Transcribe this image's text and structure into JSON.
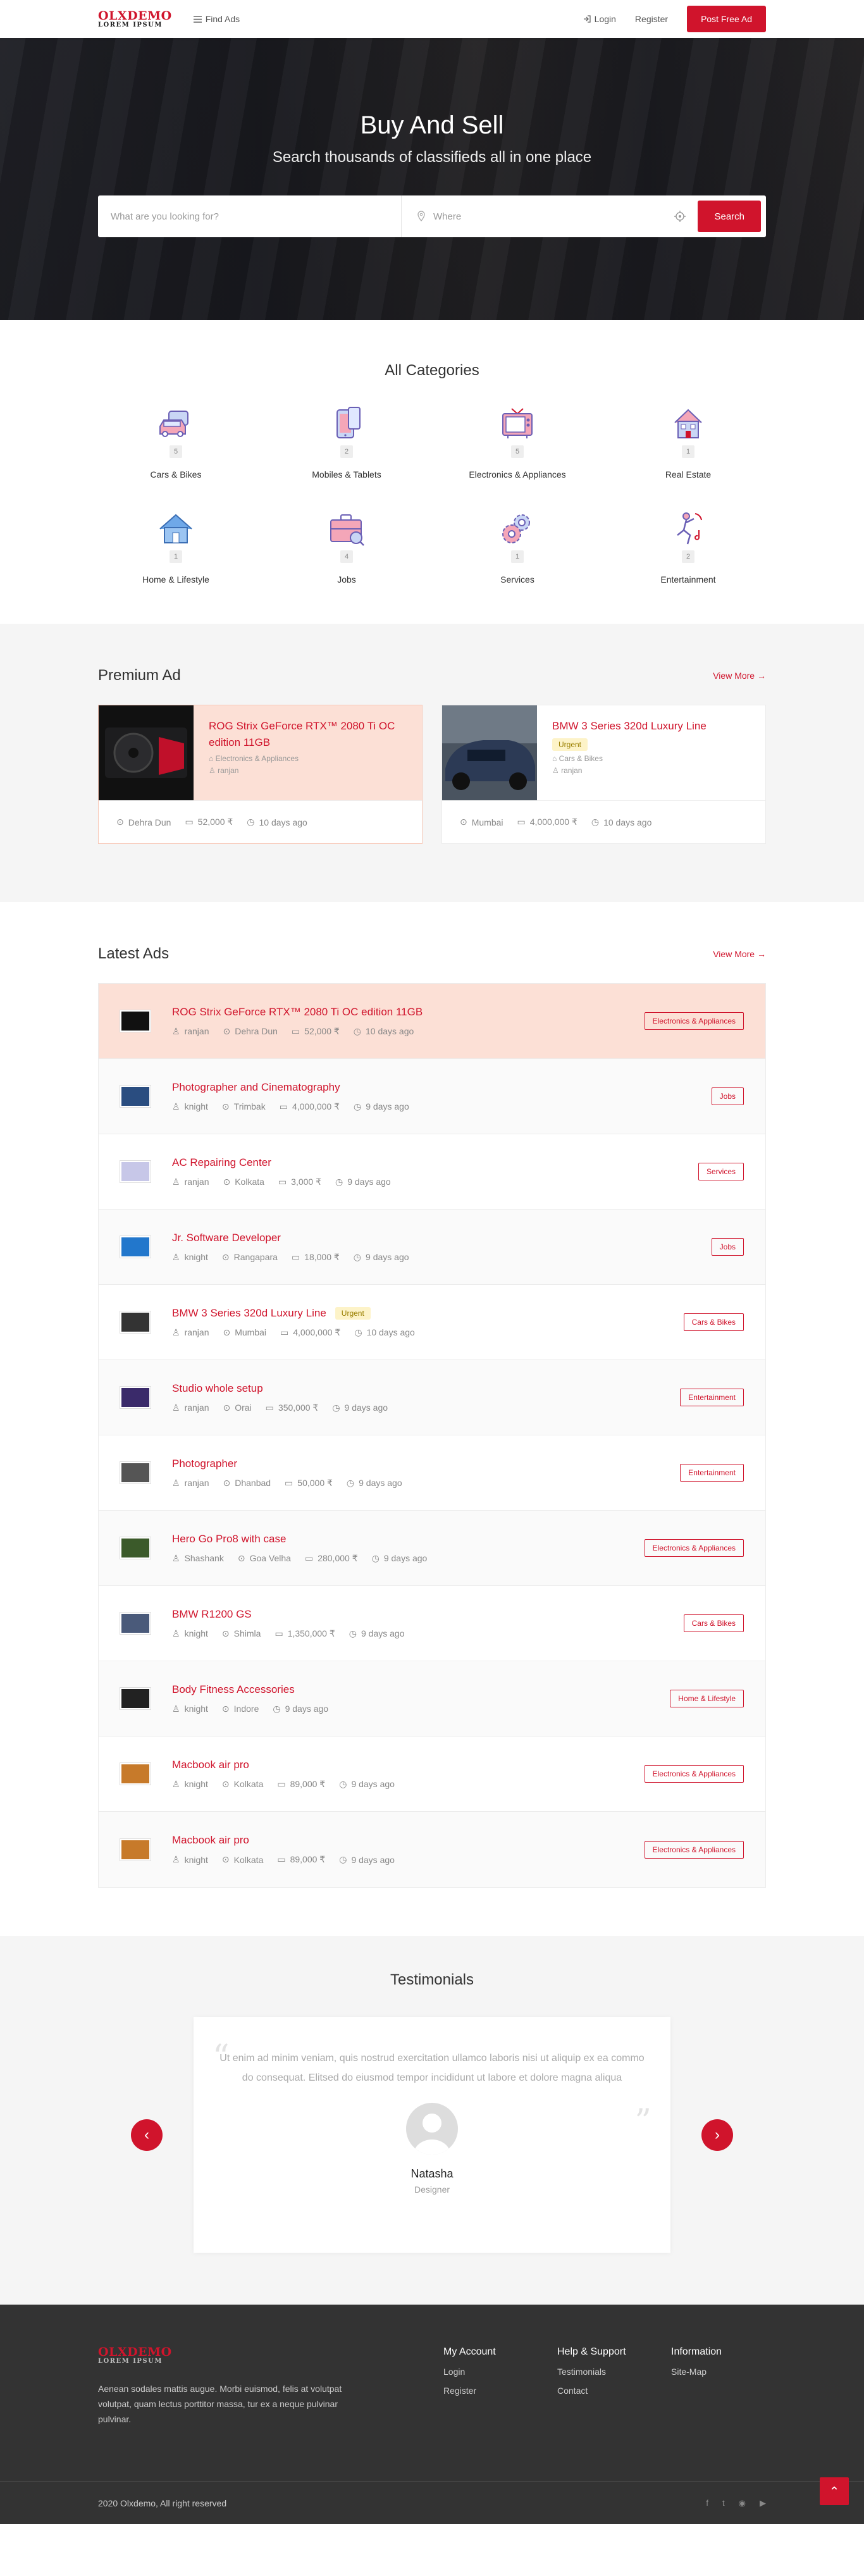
{
  "header": {
    "logo_main": "OLXDEMO",
    "logo_sub": "LOREM IPSUM",
    "find_ads": "Find Ads",
    "login": "Login",
    "register": "Register",
    "post_ad": "Post Free Ad"
  },
  "hero": {
    "title": "Buy And Sell",
    "subtitle": "Search thousands of classifieds all in one place",
    "search_placeholder": "What are you looking for?",
    "where_placeholder": "Where",
    "search_button": "Search"
  },
  "categories": {
    "title": "All Categories",
    "items": [
      {
        "name": "Cars & Bikes",
        "count": "5",
        "icon": "car-icon"
      },
      {
        "name": "Mobiles & Tablets",
        "count": "2",
        "icon": "mobile-icon"
      },
      {
        "name": "Electronics & Appliances",
        "count": "5",
        "icon": "tv-icon"
      },
      {
        "name": "Real Estate",
        "count": "1",
        "icon": "building-icon"
      },
      {
        "name": "Home & Lifestyle",
        "count": "1",
        "icon": "home-icon"
      },
      {
        "name": "Jobs",
        "count": "4",
        "icon": "briefcase-icon"
      },
      {
        "name": "Services",
        "count": "1",
        "icon": "gears-icon"
      },
      {
        "name": "Entertainment",
        "count": "2",
        "icon": "dancer-icon"
      }
    ]
  },
  "premium": {
    "title": "Premium Ad",
    "view_more": "View More",
    "items": [
      {
        "title": "ROG Strix GeForce RTX™ 2080 Ti OC edition 11GB",
        "category": "Electronics & Appliances",
        "user": "ranjan",
        "location": "Dehra Dun",
        "price": "52,000 ₹",
        "time": "10 days ago",
        "tag": ""
      },
      {
        "title": "BMW 3 Series 320d Luxury Line",
        "category": "Cars & Bikes",
        "user": "ranjan",
        "location": "Mumbai",
        "price": "4,000,000 ₹",
        "time": "10 days ago",
        "tag": "Urgent"
      }
    ]
  },
  "latest": {
    "title": "Latest Ads",
    "view_more": "View More",
    "items": [
      {
        "title": "ROG Strix GeForce RTX™ 2080 Ti OC edition 11GB",
        "user": "ranjan",
        "location": "Dehra Dun",
        "price": "52,000 ₹",
        "time": "10 days ago",
        "category": "Electronics & Appliances",
        "tag": ""
      },
      {
        "title": "Photographer and Cinematography",
        "user": "knight",
        "location": "Trimbak",
        "price": "4,000,000 ₹",
        "time": "9 days ago",
        "category": "Jobs",
        "tag": ""
      },
      {
        "title": "AC Repairing Center",
        "user": "ranjan",
        "location": "Kolkata",
        "price": "3,000 ₹",
        "time": "9 days ago",
        "category": "Services",
        "tag": ""
      },
      {
        "title": "Jr. Software Developer",
        "user": "knight",
        "location": "Rangapara",
        "price": "18,000 ₹",
        "time": "9 days ago",
        "category": "Jobs",
        "tag": ""
      },
      {
        "title": "BMW 3 Series 320d Luxury Line",
        "user": "ranjan",
        "location": "Mumbai",
        "price": "4,000,000 ₹",
        "time": "10 days ago",
        "category": "Cars & Bikes",
        "tag": "Urgent"
      },
      {
        "title": "Studio whole setup",
        "user": "ranjan",
        "location": "Orai",
        "price": "350,000 ₹",
        "time": "9 days ago",
        "category": "Entertainment",
        "tag": ""
      },
      {
        "title": "Photographer",
        "user": "ranjan",
        "location": "Dhanbad",
        "price": "50,000 ₹",
        "time": "9 days ago",
        "category": "Entertainment",
        "tag": ""
      },
      {
        "title": "Hero Go Pro8 with case",
        "user": "Shashank",
        "location": "Goa Velha",
        "price": "280,000 ₹",
        "time": "9 days ago",
        "category": "Electronics & Appliances",
        "tag": ""
      },
      {
        "title": "BMW R1200 GS",
        "user": "knight",
        "location": "Shimla",
        "price": "1,350,000 ₹",
        "time": "9 days ago",
        "category": "Cars & Bikes",
        "tag": ""
      },
      {
        "title": "Body Fitness Accessories",
        "user": "knight",
        "location": "Indore",
        "price": "",
        "time": "9 days ago",
        "category": "Home & Lifestyle",
        "tag": ""
      },
      {
        "title": "Macbook air pro",
        "user": "knight",
        "location": "Kolkata",
        "price": "89,000 ₹",
        "time": "9 days ago",
        "category": "Electronics & Appliances",
        "tag": ""
      },
      {
        "title": "Macbook air pro",
        "user": "knight",
        "location": "Kolkata",
        "price": "89,000 ₹",
        "time": "9 days ago",
        "category": "Electronics & Appliances",
        "tag": ""
      }
    ]
  },
  "testimonials": {
    "title": "Testimonials",
    "quote": "Ut enim ad minim veniam, quis nostrud exercitation ullamco laboris nisi ut aliquip ex ea commo do consequat. Elitsed do eiusmod tempor incididunt ut labore et dolore magna aliqua",
    "name": "Natasha",
    "role": "Designer"
  },
  "footer": {
    "logo_main": "OLXDEMO",
    "logo_sub": "LOREM IPSUM",
    "about": "Aenean sodales mattis augue. Morbi euismod, felis at volutpat volutpat, quam lectus porttitor massa, tur ex a neque pulvinar pulvinar.",
    "col1": {
      "title": "My Account",
      "links": [
        "Login",
        "Register"
      ]
    },
    "col2": {
      "title": "Help & Support",
      "links": [
        "Testimonials",
        "Contact"
      ]
    },
    "col3": {
      "title": "Information",
      "links": [
        "Site-Map"
      ]
    },
    "copyright": "2020 Olxdemo, All right reserved"
  },
  "colors": {
    "accent": "#d0142c",
    "highlight": "#fce0d6",
    "footer": "#333333"
  }
}
